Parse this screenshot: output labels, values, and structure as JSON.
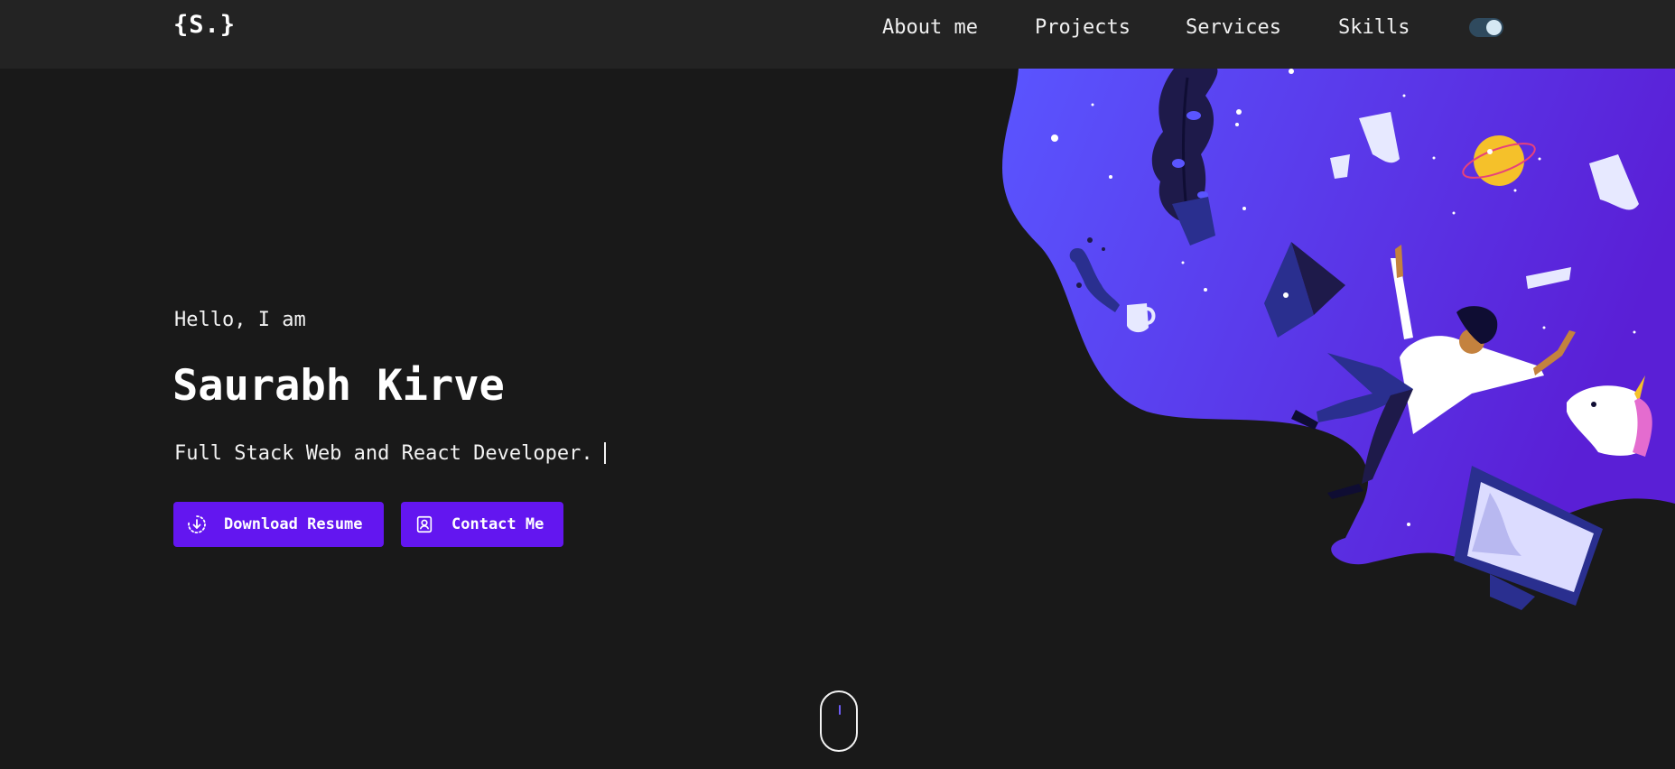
{
  "brand": {
    "logo_text": "{S.}"
  },
  "nav": {
    "items": [
      {
        "label": "About me"
      },
      {
        "label": "Projects"
      },
      {
        "label": "Services"
      },
      {
        "label": "Skills"
      }
    ],
    "theme_toggle": {
      "state": "dark"
    }
  },
  "hero": {
    "greeting": "Hello, I am",
    "name": "Saurabh Kirve",
    "tagline": "Full Stack Web and React Developer.",
    "buttons": {
      "download_label": "Download Resume",
      "download_icon": "download-icon",
      "contact_label": "Contact Me",
      "contact_icon": "contact-card-icon"
    },
    "illustration": "person-falling-in-space-illustration"
  },
  "scroll_indicator": {
    "icon": "mouse-scroll-icon"
  },
  "colors": {
    "background": "#191919",
    "navbar": "#232323",
    "accent": "#6316f0",
    "blob_start": "#5a55ff",
    "blob_end": "#5a1fd6"
  }
}
